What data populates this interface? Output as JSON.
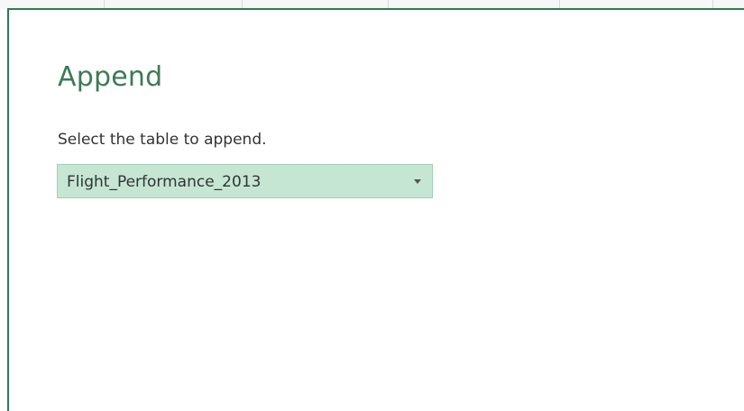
{
  "dialog": {
    "title": "Append",
    "instruction": "Select the table to append.",
    "table_select": {
      "selected_value": "Flight_Performance_2013",
      "icon": "chevron-down-icon"
    }
  },
  "colors": {
    "title": "#3d7a55",
    "border": "#2e7d52",
    "select_background": "#c6e6d4",
    "select_border": "#9fd0b5"
  }
}
